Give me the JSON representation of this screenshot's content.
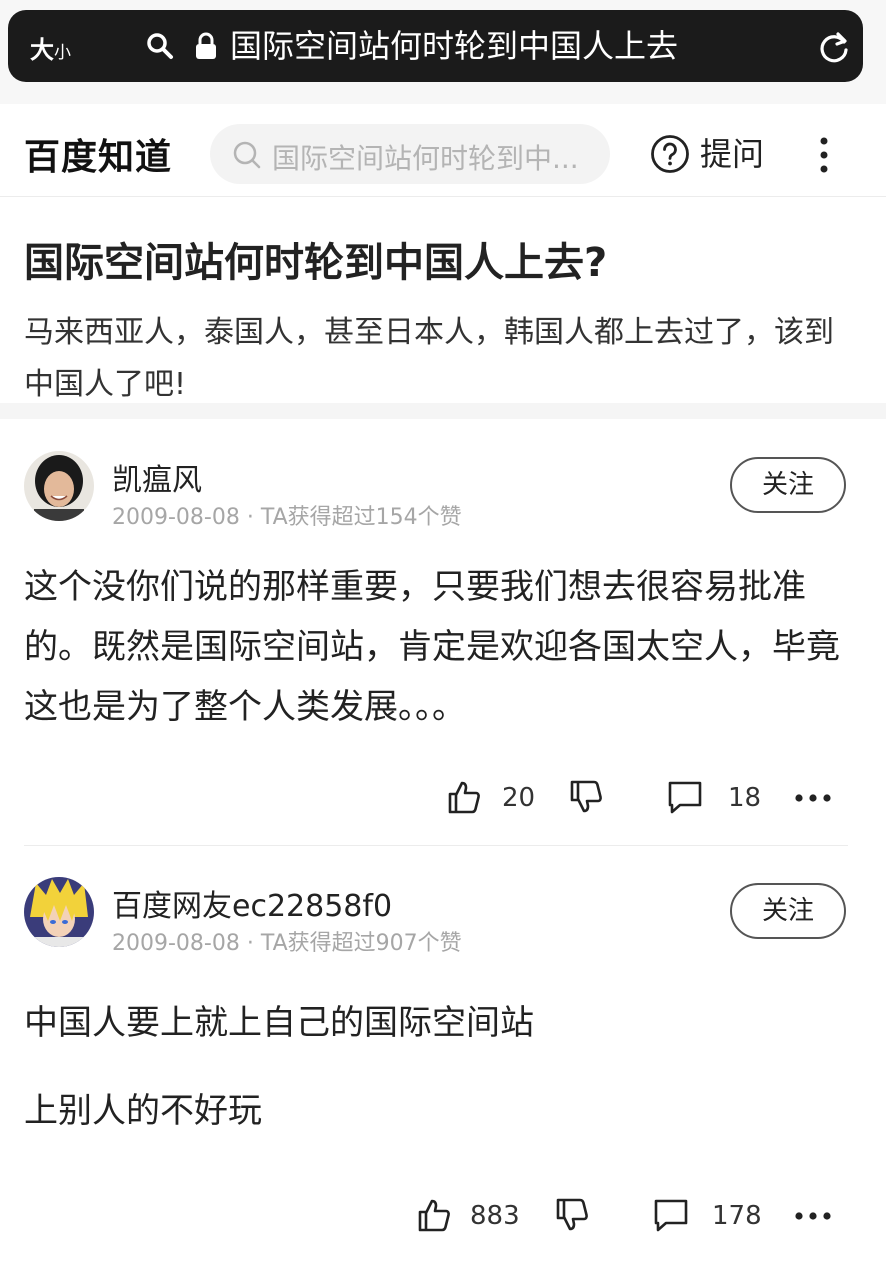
{
  "browser": {
    "font_size_label_big": "大",
    "font_size_label_small": "小",
    "address_text": "国际空间站何时轮到中国人上去"
  },
  "header": {
    "logo": "百度知道",
    "search_placeholder": "国际空间站何时轮到中...",
    "ask_label": "提问"
  },
  "question": {
    "title": "国际空间站何时轮到中国人上去?",
    "description": "马来西亚人，泰国人，甚至日本人，韩国人都上去过了，该到中国人了吧!"
  },
  "answers": [
    {
      "username": "凯瘟风",
      "meta": "2009-08-08 · TA获得超过154个赞",
      "follow_label": "关注",
      "paragraphs": [
        "这个没你们说的那样重要，只要我们想去很容易批准的。既然是国际空间站，肯定是欢迎各国太空人，毕竟这也是为了整个人类发展。。。"
      ],
      "likes": "20",
      "comments": "18"
    },
    {
      "username": "百度网友ec22858f0",
      "meta": "2009-08-08 · TA获得超过907个赞",
      "follow_label": "关注",
      "paragraphs": [
        "中国人要上就上自己的国际空间站",
        "上别人的不好玩"
      ],
      "likes": "883",
      "comments": "178"
    }
  ]
}
